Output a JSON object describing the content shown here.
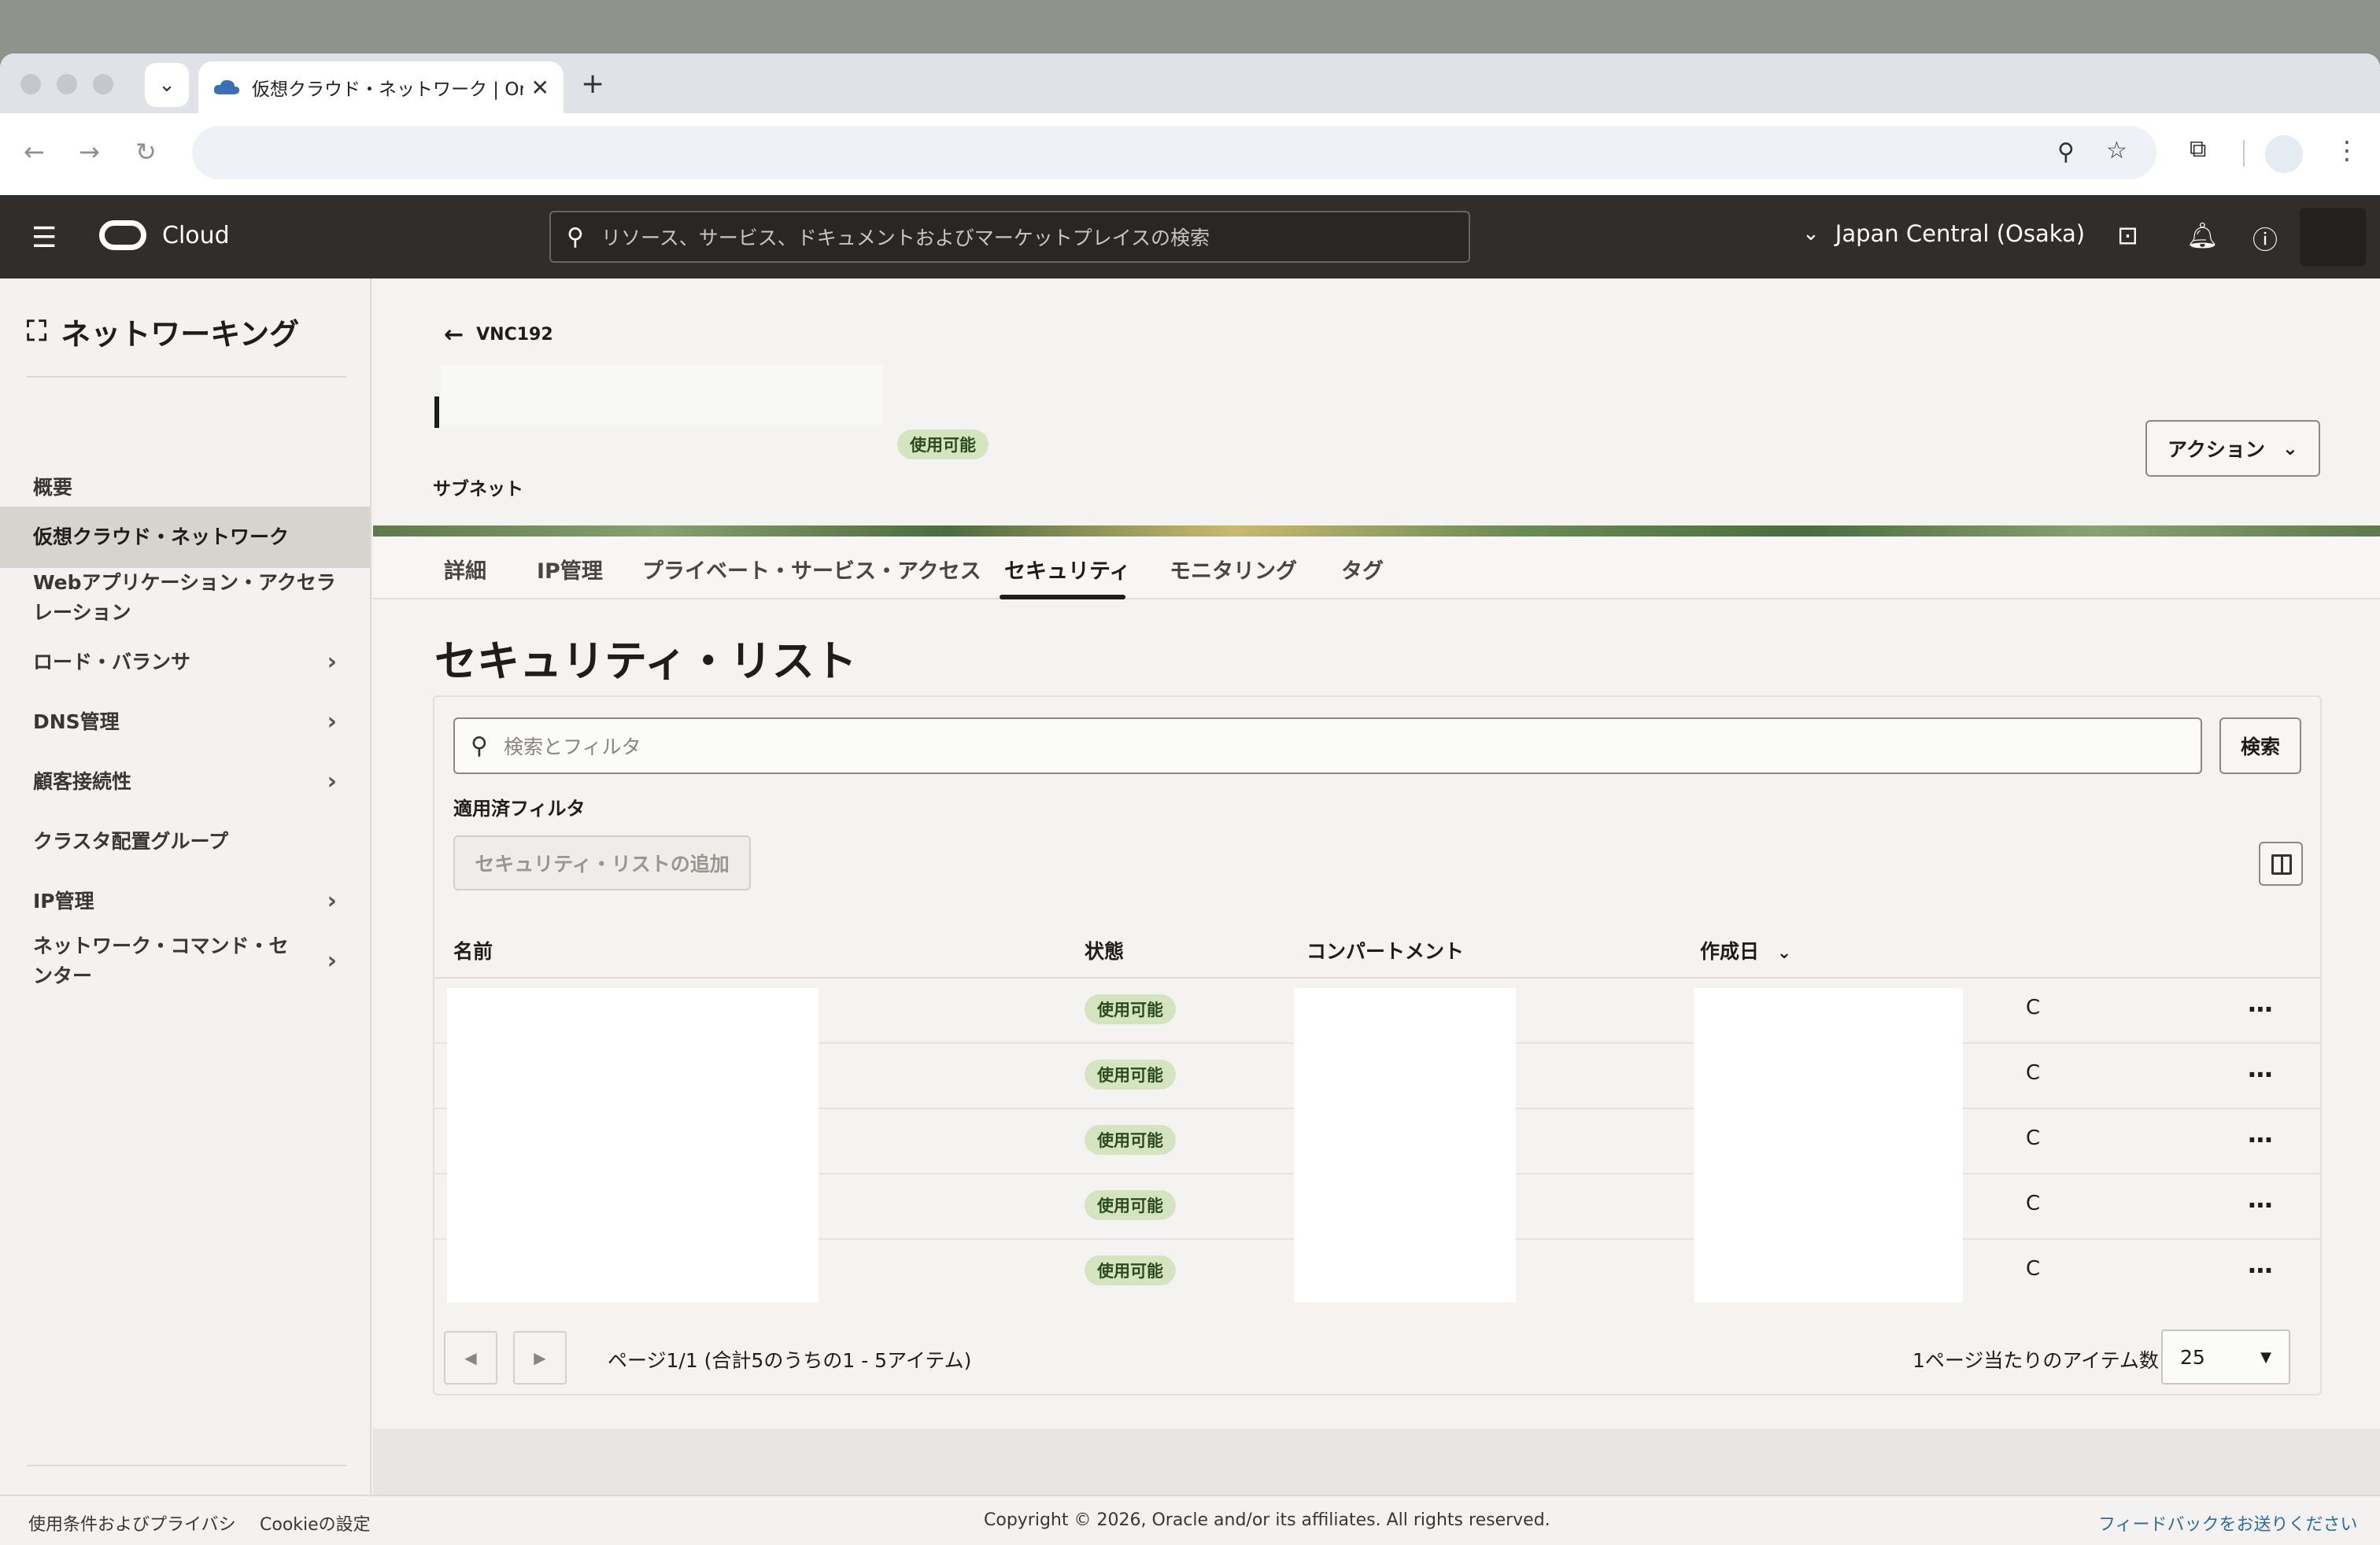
{
  "browser": {
    "tab_title": "仮想クラウド・ネットワーク | Or",
    "tab_close": "✕",
    "new_tab": "+"
  },
  "header": {
    "brand": "Cloud",
    "search_placeholder": "リソース、サービス、ドキュメントおよびマーケットプレイスの検索",
    "region": "Japan Central (Osaka)"
  },
  "sidebar": {
    "title": "ネットワーキング",
    "items": [
      {
        "label": "概要",
        "has_chevron": false,
        "active": false
      },
      {
        "label": "仮想クラウド・ネットワーク",
        "has_chevron": false,
        "active": true
      },
      {
        "label": "Webアプリケーション・アクセラレーション",
        "has_chevron": false,
        "active": false
      },
      {
        "label": "ロード・バランサ",
        "has_chevron": true,
        "active": false
      },
      {
        "label": "DNS管理",
        "has_chevron": true,
        "active": false
      },
      {
        "label": "顧客接続性",
        "has_chevron": true,
        "active": false
      },
      {
        "label": "クラスタ配置グループ",
        "has_chevron": false,
        "active": false
      },
      {
        "label": "IP管理",
        "has_chevron": true,
        "active": false
      },
      {
        "label": "ネットワーク・コマンド・センター",
        "has_chevron": true,
        "active": false
      }
    ]
  },
  "page": {
    "back_label": "VNC192",
    "status": "使用可能",
    "subtitle": "サブネット",
    "action_label": "アクション",
    "tabs": [
      "詳細",
      "IP管理",
      "プライベート・サービス・アクセス",
      "セキュリティ",
      "モニタリング",
      "タグ"
    ],
    "active_tab": "セキュリティ",
    "section_title": "セキュリティ・リスト",
    "filter_placeholder": "検索とフィルタ",
    "search_button": "検索",
    "applied_filters_label": "適用済フィルタ",
    "add_button": "セキュリティ・リストの追加",
    "table": {
      "columns": [
        "名前",
        "状態",
        "コンパートメント",
        "作成日"
      ],
      "rows": [
        {
          "status": "使用可能",
          "created_fragment": "C"
        },
        {
          "status": "使用可能",
          "created_fragment": "C"
        },
        {
          "status": "使用可能",
          "created_fragment": "C"
        },
        {
          "status": "使用可能",
          "created_fragment": "C"
        },
        {
          "status": "使用可能",
          "created_fragment": "C"
        }
      ]
    },
    "pagination": {
      "text": "ページ1/1 (合計5のうちの1 - 5アイテム)",
      "per_page_label": "1ページ当たりのアイテム数",
      "per_page_value": "25"
    }
  },
  "footer": {
    "terms": "使用条件およびプライバシ",
    "cookie": "Cookieの設定",
    "copyright": "Copyright © 2026, Oracle and/or its affiliates. All rights reserved.",
    "feedback": "フィードバックをお送りください"
  }
}
